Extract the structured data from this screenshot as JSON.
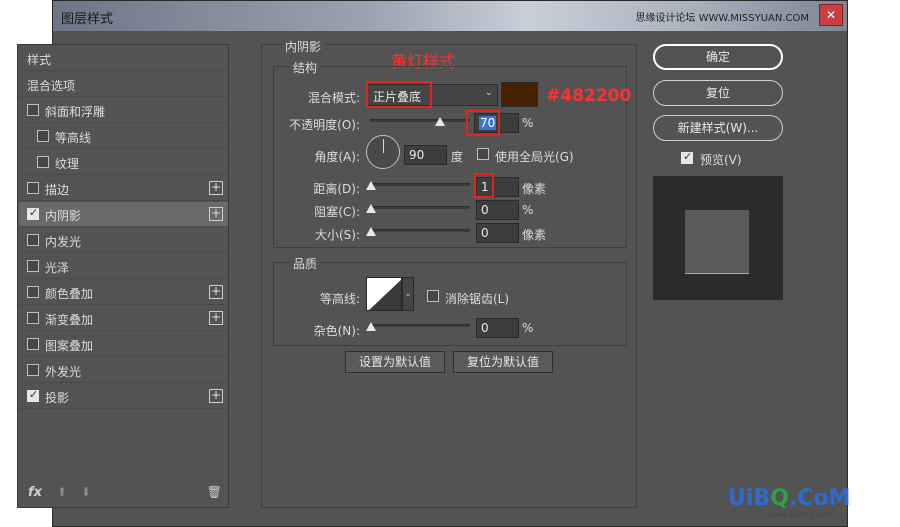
{
  "window": {
    "title": "图层样式",
    "watermark": "思缘设计论坛 WWW.MISSYUAN.COM",
    "close_label": "✕"
  },
  "list": {
    "items": [
      {
        "label": "样式",
        "checkbox": false,
        "plus": false,
        "indent": 0
      },
      {
        "label": "混合选项",
        "checkbox": false,
        "plus": false,
        "indent": 0
      },
      {
        "label": "斜面和浮雕",
        "checkbox": true,
        "checked": false,
        "plus": false,
        "indent": 0
      },
      {
        "label": "等高线",
        "checkbox": true,
        "checked": false,
        "plus": false,
        "indent": 1
      },
      {
        "label": "纹理",
        "checkbox": true,
        "checked": false,
        "plus": false,
        "indent": 1
      },
      {
        "label": "描边",
        "checkbox": true,
        "checked": false,
        "plus": true,
        "indent": 0
      },
      {
        "label": "内阴影",
        "checkbox": true,
        "checked": true,
        "plus": true,
        "indent": 0,
        "selected": true
      },
      {
        "label": "内发光",
        "checkbox": true,
        "checked": false,
        "plus": false,
        "indent": 0
      },
      {
        "label": "光泽",
        "checkbox": true,
        "checked": false,
        "plus": false,
        "indent": 0
      },
      {
        "label": "颜色叠加",
        "checkbox": true,
        "checked": false,
        "plus": true,
        "indent": 0
      },
      {
        "label": "渐变叠加",
        "checkbox": true,
        "checked": false,
        "plus": true,
        "indent": 0
      },
      {
        "label": "图案叠加",
        "checkbox": true,
        "checked": false,
        "plus": false,
        "indent": 0
      },
      {
        "label": "外发光",
        "checkbox": true,
        "checked": false,
        "plus": false,
        "indent": 0
      },
      {
        "label": "投影",
        "checkbox": true,
        "checked": true,
        "plus": true,
        "indent": 0
      }
    ],
    "footer": {
      "fx": "fx",
      "up": "⬆",
      "down": "⬇",
      "trash": "🗑"
    }
  },
  "inner_shadow": {
    "title": "内阴影",
    "annotation": "黄灯样式",
    "structure": {
      "title": "结构",
      "blend_mode_label": "混合模式:",
      "blend_mode_value": "正片叠底",
      "color_hex": "#482200",
      "color_annotation": "#482200",
      "opacity_label": "不透明度(O):",
      "opacity_value": "70",
      "opacity_percent": 70,
      "percent_unit": "%",
      "angle_label": "角度(A):",
      "angle_value": "90",
      "angle_unit": "度",
      "global_light_label": "使用全局光(G)",
      "distance_label": "距离(D):",
      "distance_value": "1",
      "distance_unit": "像素",
      "choke_label": "阻塞(C):",
      "choke_value": "0",
      "choke_unit": "%",
      "size_label": "大小(S):",
      "size_value": "0",
      "size_unit": "像素"
    },
    "quality": {
      "title": "品质",
      "contour_label": "等高线:",
      "antialias_label": "消除锯齿(L)",
      "noise_label": "杂色(N):",
      "noise_value": "0",
      "noise_unit": "%"
    },
    "buttons": {
      "set_default": "设置为默认值",
      "reset_default": "复位为默认值"
    }
  },
  "right": {
    "ok": "确定",
    "reset": "复位",
    "new_style": "新建样式(W)...",
    "preview_label": "预览(V)",
    "preview_checked": true
  },
  "logo": {
    "main_a": "UiB",
    "main_o": "Q",
    "main_b": ".CoM",
    "sub": "www.psahz.com"
  }
}
